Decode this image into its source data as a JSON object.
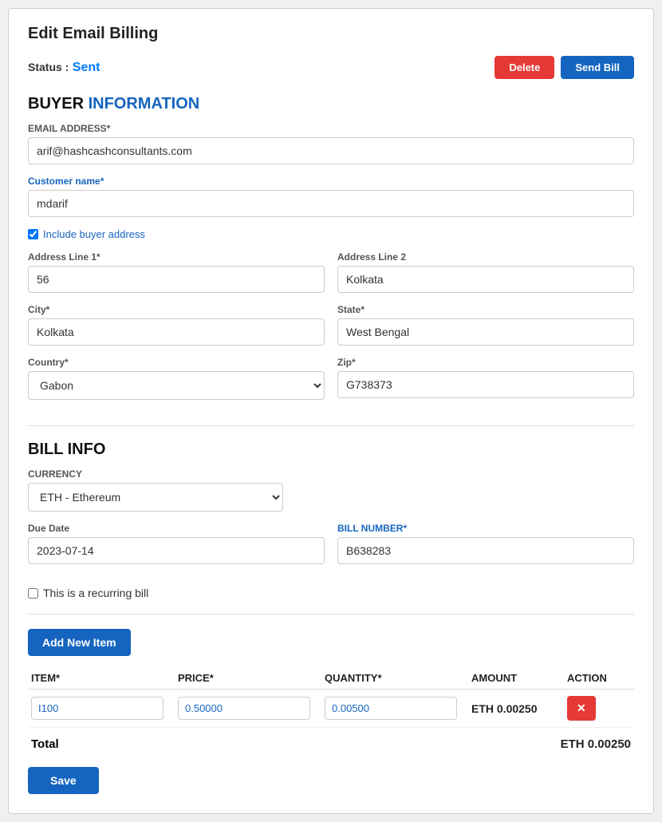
{
  "page": {
    "title": "Edit Email Billing"
  },
  "status": {
    "label": "Status :",
    "value": "Sent"
  },
  "buttons": {
    "delete": "Delete",
    "send_bill": "Send Bill",
    "add_new_item": "Add New Item",
    "save": "Save"
  },
  "buyer_section": {
    "title_plain": "BUYER ",
    "title_highlight": "INFORMATION",
    "email_label": "EMAIL ADDRESS*",
    "email_value": "arif@hashcashconsultants.com",
    "customer_name_label": "Customer name*",
    "customer_name_value": "mdarif",
    "include_address_label": "Include buyer address",
    "address_line1_label": "Address Line 1*",
    "address_line1_value": "56",
    "address_line2_label": "Address Line 2",
    "address_line2_value": "Kolkata",
    "city_label": "City*",
    "city_value": "Kolkata",
    "state_label": "State*",
    "state_value": "West Bengal",
    "country_label": "Country*",
    "country_value": "Gabon",
    "zip_label": "Zip*",
    "zip_value": "G738373"
  },
  "bill_section": {
    "title": "BILL INFO",
    "currency_label": "CURRENCY",
    "currency_value": "ETH - Ethereum",
    "due_date_label": "Due Date",
    "due_date_value": "2023-07-14",
    "bill_number_label": "BILL NUMBER*",
    "bill_number_value": "B638283",
    "recurring_label": "This is a recurring bill"
  },
  "table": {
    "headers": {
      "item": "ITEM*",
      "price": "PRICE*",
      "quantity": "QUANTITY*",
      "amount": "AMOUNT",
      "action": "ACTION"
    },
    "rows": [
      {
        "item": "I100",
        "price": "0.50000",
        "quantity": "0.00500",
        "amount": "ETH  0.00250"
      }
    ]
  },
  "total": {
    "label": "Total",
    "value": "ETH  0.00250"
  }
}
